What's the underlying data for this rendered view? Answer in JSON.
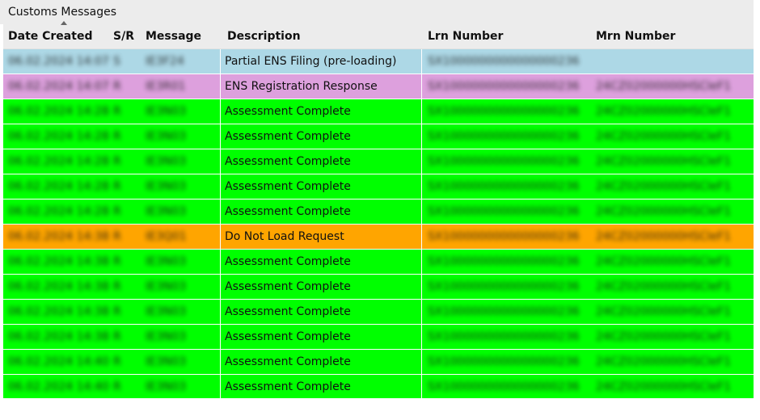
{
  "group_title": "Customs Messages",
  "colors": {
    "blue": "#add8e6",
    "violet": "#dda0dd",
    "green": "#00ff00",
    "orange": "#ffa500"
  },
  "columns": [
    {
      "key": "date",
      "label": "Date Created"
    },
    {
      "key": "sr",
      "label": "S/R"
    },
    {
      "key": "message",
      "label": "Message"
    },
    {
      "key": "description",
      "label": "Description"
    },
    {
      "key": "lrn",
      "label": "Lrn Number"
    },
    {
      "key": "mrn",
      "label": "Mrn Number"
    }
  ],
  "rows": [
    {
      "color": "blue",
      "date": "06.02.2024 14:07",
      "sr": "S",
      "message": "IE3F24",
      "description": "Partial ENS Filing (pre-loading)",
      "lrn": "SX1000000000000000236",
      "mrn": ""
    },
    {
      "color": "violet",
      "date": "06.02.2024 14:07",
      "sr": "R",
      "message": "IE3R01",
      "description": "ENS Registration Response",
      "lrn": "SX1000000000000000236",
      "mrn": "24CZ02000000HSCleF1"
    },
    {
      "color": "green",
      "date": "06.02.2024 14:28",
      "sr": "R",
      "message": "IE3N03",
      "description": "Assessment Complete",
      "lrn": "SX1000000000000000236",
      "mrn": "24CZ02000000HSCleF1"
    },
    {
      "color": "green",
      "date": "06.02.2024 14:28",
      "sr": "R",
      "message": "IE3N03",
      "description": "Assessment Complete",
      "lrn": "SX1000000000000000236",
      "mrn": "24CZ02000000HSCleF1"
    },
    {
      "color": "green",
      "date": "06.02.2024 14:28",
      "sr": "R",
      "message": "IE3N03",
      "description": "Assessment Complete",
      "lrn": "SX1000000000000000236",
      "mrn": "24CZ02000000HSCleF1"
    },
    {
      "color": "green",
      "date": "06.02.2024 14:28",
      "sr": "R",
      "message": "IE3N03",
      "description": "Assessment Complete",
      "lrn": "SX1000000000000000236",
      "mrn": "24CZ02000000HSCleF1"
    },
    {
      "color": "green",
      "date": "06.02.2024 14:28",
      "sr": "R",
      "message": "IE3N03",
      "description": "Assessment Complete",
      "lrn": "SX1000000000000000236",
      "mrn": "24CZ02000000HSCleF1"
    },
    {
      "color": "orange",
      "date": "06.02.2024 14:38",
      "sr": "R",
      "message": "IE3Q01",
      "description": "Do Not Load Request",
      "lrn": "SX1000000000000000236",
      "mrn": "24CZ02000000HSCleF1"
    },
    {
      "color": "green",
      "date": "06.02.2024 14:38",
      "sr": "R",
      "message": "IE3N03",
      "description": "Assessment Complete",
      "lrn": "SX1000000000000000236",
      "mrn": "24CZ02000000HSCleF1"
    },
    {
      "color": "green",
      "date": "06.02.2024 14:38",
      "sr": "R",
      "message": "IE3N03",
      "description": "Assessment Complete",
      "lrn": "SX1000000000000000236",
      "mrn": "24CZ02000000HSCleF1"
    },
    {
      "color": "green",
      "date": "06.02.2024 14:38",
      "sr": "R",
      "message": "IE3N03",
      "description": "Assessment Complete",
      "lrn": "SX1000000000000000236",
      "mrn": "24CZ02000000HSCleF1"
    },
    {
      "color": "green",
      "date": "06.02.2024 14:38",
      "sr": "R",
      "message": "IE3N03",
      "description": "Assessment Complete",
      "lrn": "SX1000000000000000236",
      "mrn": "24CZ02000000HSCleF1"
    },
    {
      "color": "green",
      "date": "06.02.2024 14:40",
      "sr": "R",
      "message": "IE3N03",
      "description": "Assessment Complete",
      "lrn": "SX1000000000000000236",
      "mrn": "24CZ02000000HSCleF1"
    },
    {
      "color": "green",
      "date": "06.02.2024 14:40",
      "sr": "R",
      "message": "IE3N03",
      "description": "Assessment Complete",
      "lrn": "SX1000000000000000236",
      "mrn": "24CZ02000000HSCleF1"
    }
  ]
}
